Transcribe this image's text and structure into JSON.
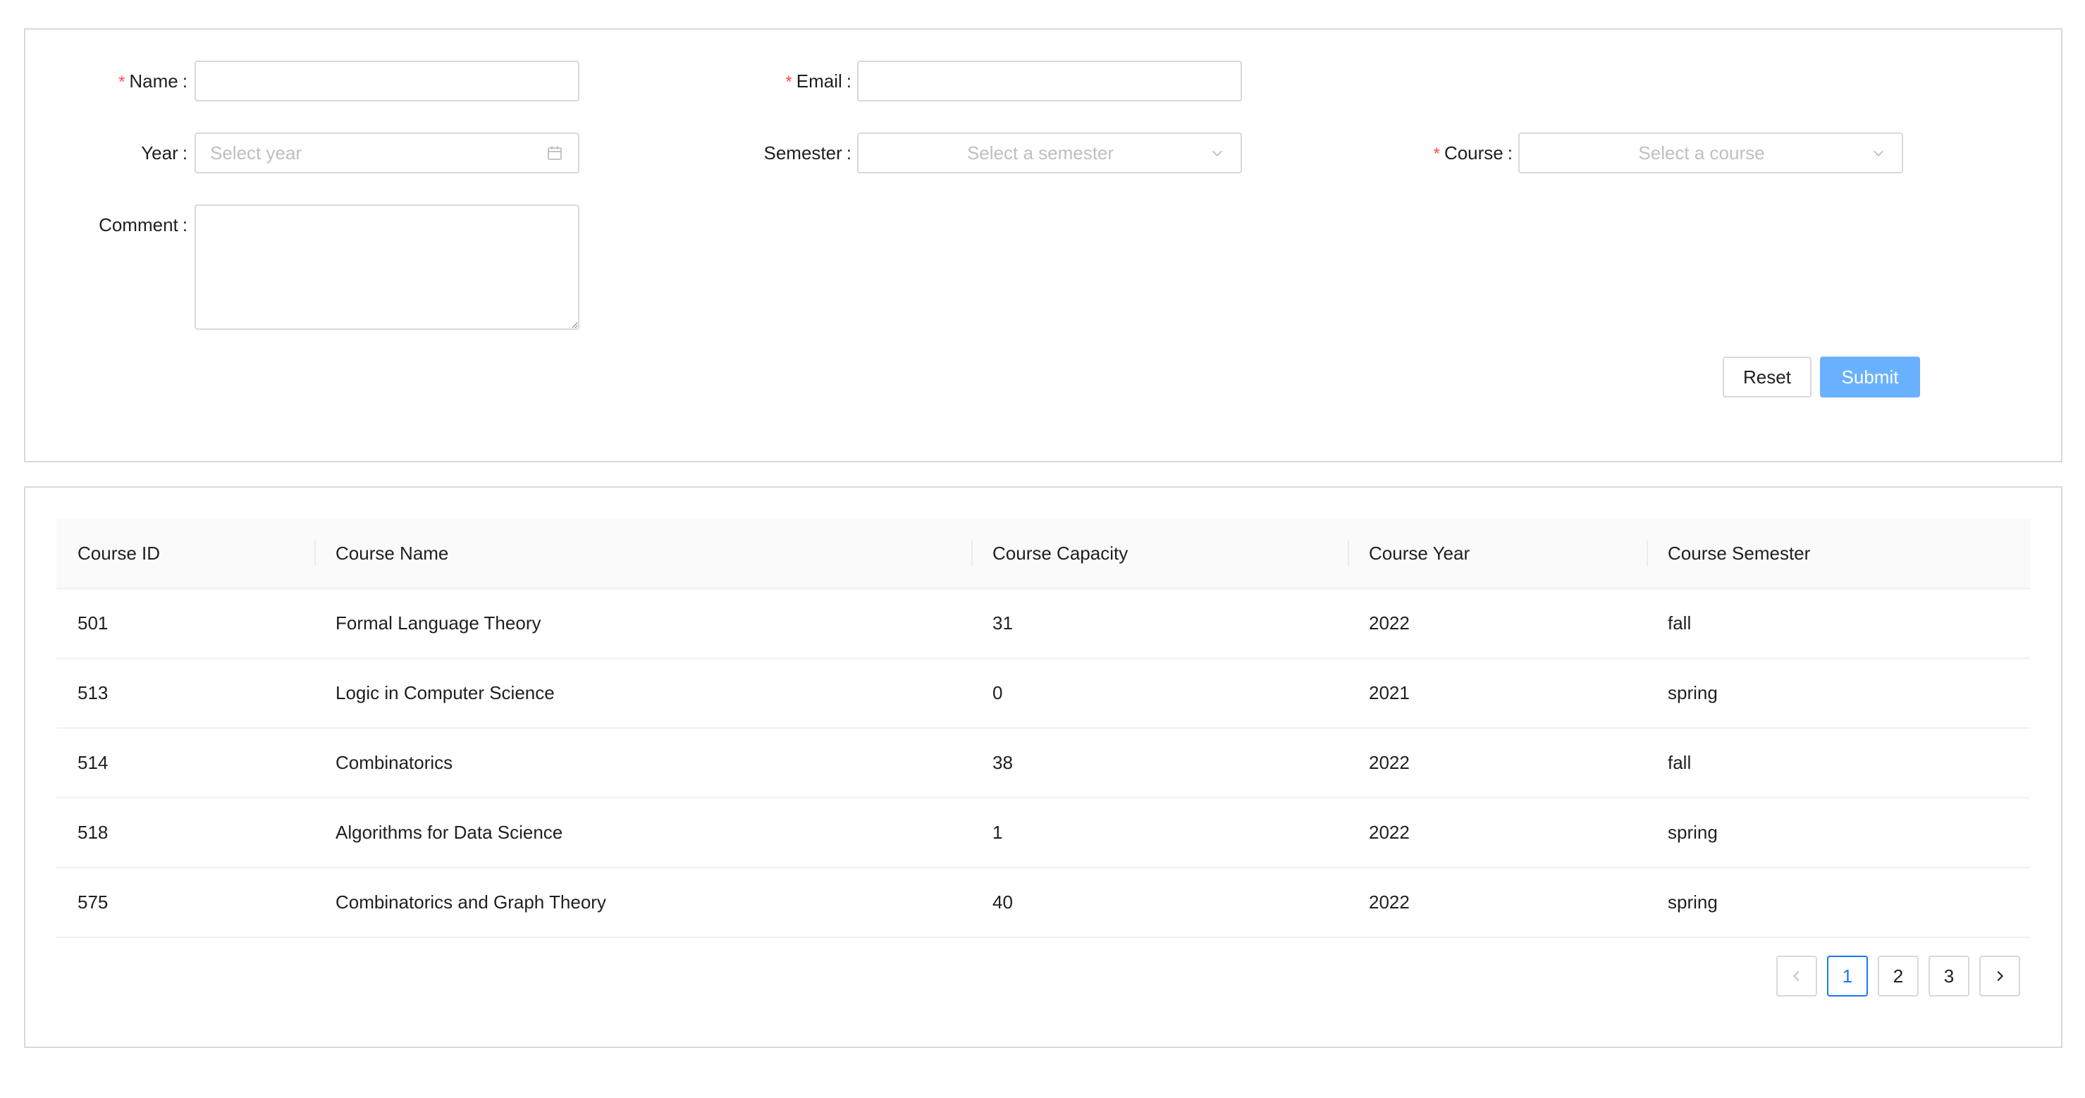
{
  "form": {
    "name": {
      "label": "Name",
      "required_mark": "*",
      "value": "",
      "placeholder": ""
    },
    "email": {
      "label": "Email",
      "required_mark": "*",
      "value": "",
      "placeholder": ""
    },
    "year": {
      "label": "Year",
      "placeholder": "Select year"
    },
    "semester": {
      "label": "Semester",
      "placeholder": "Select a semester"
    },
    "course": {
      "label": "Course",
      "required_mark": "*",
      "placeholder": "Select a course"
    },
    "comment": {
      "label": "Comment",
      "value": "",
      "placeholder": ""
    },
    "colon": ":",
    "reset_label": "Reset",
    "submit_label": "Submit"
  },
  "table": {
    "columns": [
      "Course ID",
      "Course Name",
      "Course Capacity",
      "Course Year",
      "Course Semester"
    ],
    "rows": [
      [
        "501",
        "Formal Language Theory",
        "31",
        "2022",
        "fall"
      ],
      [
        "513",
        "Logic in Computer Science",
        "0",
        "2021",
        "spring"
      ],
      [
        "514",
        "Combinatorics",
        "38",
        "2022",
        "fall"
      ],
      [
        "518",
        "Algorithms for Data Science",
        "1",
        "2022",
        "spring"
      ],
      [
        "575",
        "Combinatorics and Graph Theory",
        "40",
        "2022",
        "spring"
      ]
    ]
  },
  "pagination": {
    "pages": [
      "1",
      "2",
      "3"
    ],
    "current": "1"
  },
  "colors": {
    "primary": "#1677ff",
    "submit_bg": "#69b1ff",
    "required": "#ff4d4f",
    "border": "#d9d9d9"
  },
  "icons": {
    "year_picker": "calendar-icon",
    "select_arrow": "chevron-down-icon",
    "prev": "chevron-left-icon",
    "next": "chevron-right-icon"
  }
}
